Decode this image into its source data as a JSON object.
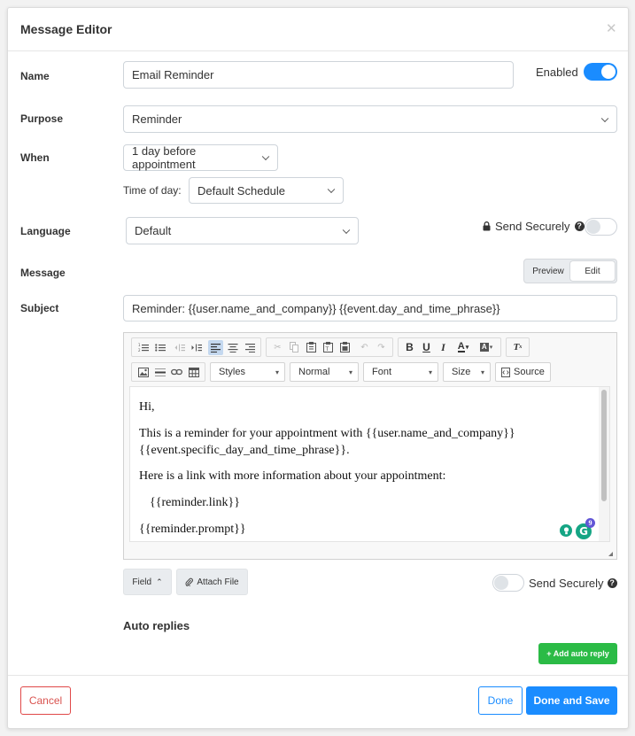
{
  "modal": {
    "title": "Message Editor",
    "close_icon": "close-icon"
  },
  "name": {
    "label": "Name",
    "value": "Email Reminder",
    "enabled_label": "Enabled",
    "enabled": true
  },
  "purpose": {
    "label": "Purpose",
    "value": "Reminder"
  },
  "when": {
    "label": "When",
    "value": "1 day before appointment",
    "time_of_day_label": "Time of day:",
    "time_of_day_value": "Default Schedule"
  },
  "language": {
    "label": "Language",
    "value": "Default",
    "send_securely_label": "Send Securely",
    "send_securely": false
  },
  "message": {
    "label": "Message",
    "preview_label": "Preview",
    "edit_label": "Edit",
    "active_tab": "Edit"
  },
  "subject": {
    "label": "Subject",
    "value": "Reminder: {{user.name_and_company}} {{event.day_and_time_phrase}}"
  },
  "editor": {
    "styles_label": "Styles",
    "format_label": "Normal",
    "font_label": "Font",
    "size_label": "Size",
    "source_label": "Source",
    "toolbar_icons": [
      "numbered-list-icon",
      "bullet-list-icon",
      "outdent-icon",
      "indent-icon",
      "align-left-icon",
      "align-center-icon",
      "align-right-icon",
      "cut-icon",
      "copy-icon",
      "paste-icon",
      "paste-text-icon",
      "paste-word-icon",
      "undo-icon",
      "redo-icon",
      "bold-icon",
      "underline-icon",
      "italic-icon",
      "text-color-icon",
      "background-color-icon",
      "remove-format-icon",
      "image-icon",
      "horizontal-rule-icon",
      "link-icon",
      "table-icon"
    ],
    "content": [
      "Hi,",
      "This is a reminder for your appointment with {{user.name_and_company}}",
      "{{event.specific_day_and_time_phrase}}.",
      "Here is a link with more information about your appointment:",
      "{{reminder.link}}",
      "{{reminder.prompt}}"
    ],
    "grammarly_badge": "9"
  },
  "footer_actions": {
    "field_label": "Field",
    "attach_label": "Attach File",
    "send_securely_label": "Send Securely",
    "send_securely": false
  },
  "auto_replies": {
    "heading": "Auto replies",
    "add_label": "+ Add auto reply"
  },
  "buttons": {
    "cancel": "Cancel",
    "done": "Done",
    "done_and_save": "Done and Save"
  },
  "colors": {
    "primary": "#1a8cff",
    "danger": "#d9534f",
    "success": "#2bbb46"
  }
}
